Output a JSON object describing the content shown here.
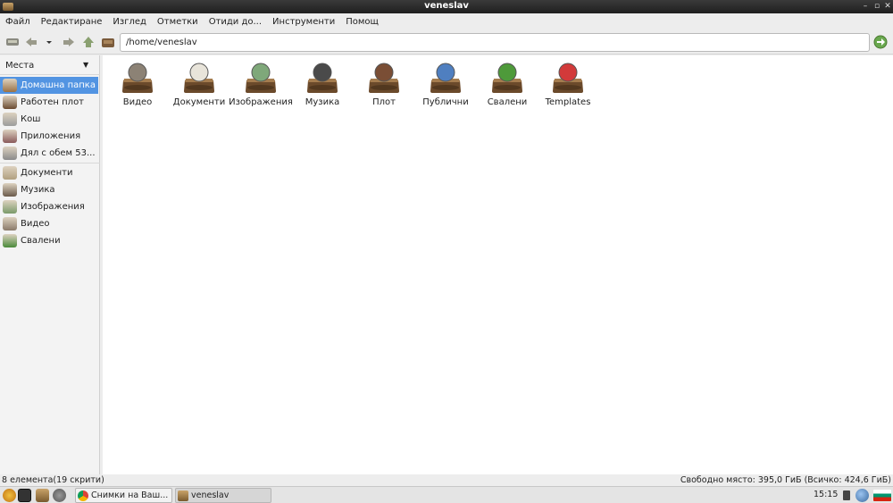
{
  "window": {
    "title": "veneslav",
    "buttons": [
      "–",
      "▫",
      "✕"
    ]
  },
  "menu": [
    "Файл",
    "Редактиране",
    "Изглед",
    "Отметки",
    "Отиди до...",
    "Инструменти",
    "Помощ"
  ],
  "toolbar": {
    "icons": [
      "computer-icon",
      "back-icon",
      "dropdown-icon",
      "forward-icon",
      "up-icon",
      "home-icon"
    ]
  },
  "location": {
    "value": "/home/veneslav"
  },
  "sidebar": {
    "header": "Места",
    "items": [
      {
        "label": "Домашна папка",
        "icon": "home-folder-icon",
        "color": "#9a7145",
        "active": true
      },
      {
        "label": "Работен плот",
        "icon": "desktop-icon",
        "color": "#6a4a30"
      },
      {
        "label": "Кош",
        "icon": "trash-icon",
        "color": "#9c9c9c"
      },
      {
        "label": "Приложения",
        "icon": "applications-icon",
        "color": "#8a5a5a"
      },
      {
        "label": "Дял с обем 53...",
        "icon": "drive-icon",
        "color": "#8a8a8a"
      },
      {
        "label": "Документи",
        "icon": "documents-icon",
        "color": "#b0a080"
      },
      {
        "label": "Музика",
        "icon": "music-icon",
        "color": "#6a5a4a"
      },
      {
        "label": "Изображения",
        "icon": "pictures-icon",
        "color": "#7a9a6a"
      },
      {
        "label": "Видео",
        "icon": "videos-icon",
        "color": "#8a7a6a"
      },
      {
        "label": "Свалени",
        "icon": "downloads-icon",
        "color": "#4a8a3a"
      }
    ]
  },
  "files": [
    {
      "name": "Видео",
      "icon": "video-folder-icon",
      "accent": "#8c8275"
    },
    {
      "name": "Документи",
      "icon": "documents-folder-icon",
      "accent": "#e8e4da"
    },
    {
      "name": "Изображения",
      "icon": "pictures-folder-icon",
      "accent": "#7fa87a"
    },
    {
      "name": "Музика",
      "icon": "music-folder-icon",
      "accent": "#4a4a4a"
    },
    {
      "name": "Плот",
      "icon": "desktop-folder-icon",
      "accent": "#7a4e35"
    },
    {
      "name": "Публични",
      "icon": "public-folder-icon",
      "accent": "#4f7fc0"
    },
    {
      "name": "Свалени",
      "icon": "downloads-folder-icon",
      "accent": "#4e9a3a"
    },
    {
      "name": "Templates",
      "icon": "templates-folder-icon",
      "accent": "#d23a3a"
    }
  ],
  "status": {
    "left": "8 елемента(19 скрити)",
    "right": "Свободно място: 395,0 ГиБ (Всичко: 424,6 ГиБ)"
  },
  "taskbar": {
    "launchers": [
      "menu-icon",
      "terminal-icon",
      "file-manager-icon",
      "settings-icon"
    ],
    "tasks": [
      {
        "label": "Снимки на Ваш...",
        "icon": "chrome-icon"
      },
      {
        "label": "veneslav",
        "icon": "folder-icon",
        "active": true
      }
    ],
    "clock": "15:15",
    "tray": [
      "battery-icon",
      "network-icon",
      "bulgarian-flag-icon"
    ]
  }
}
